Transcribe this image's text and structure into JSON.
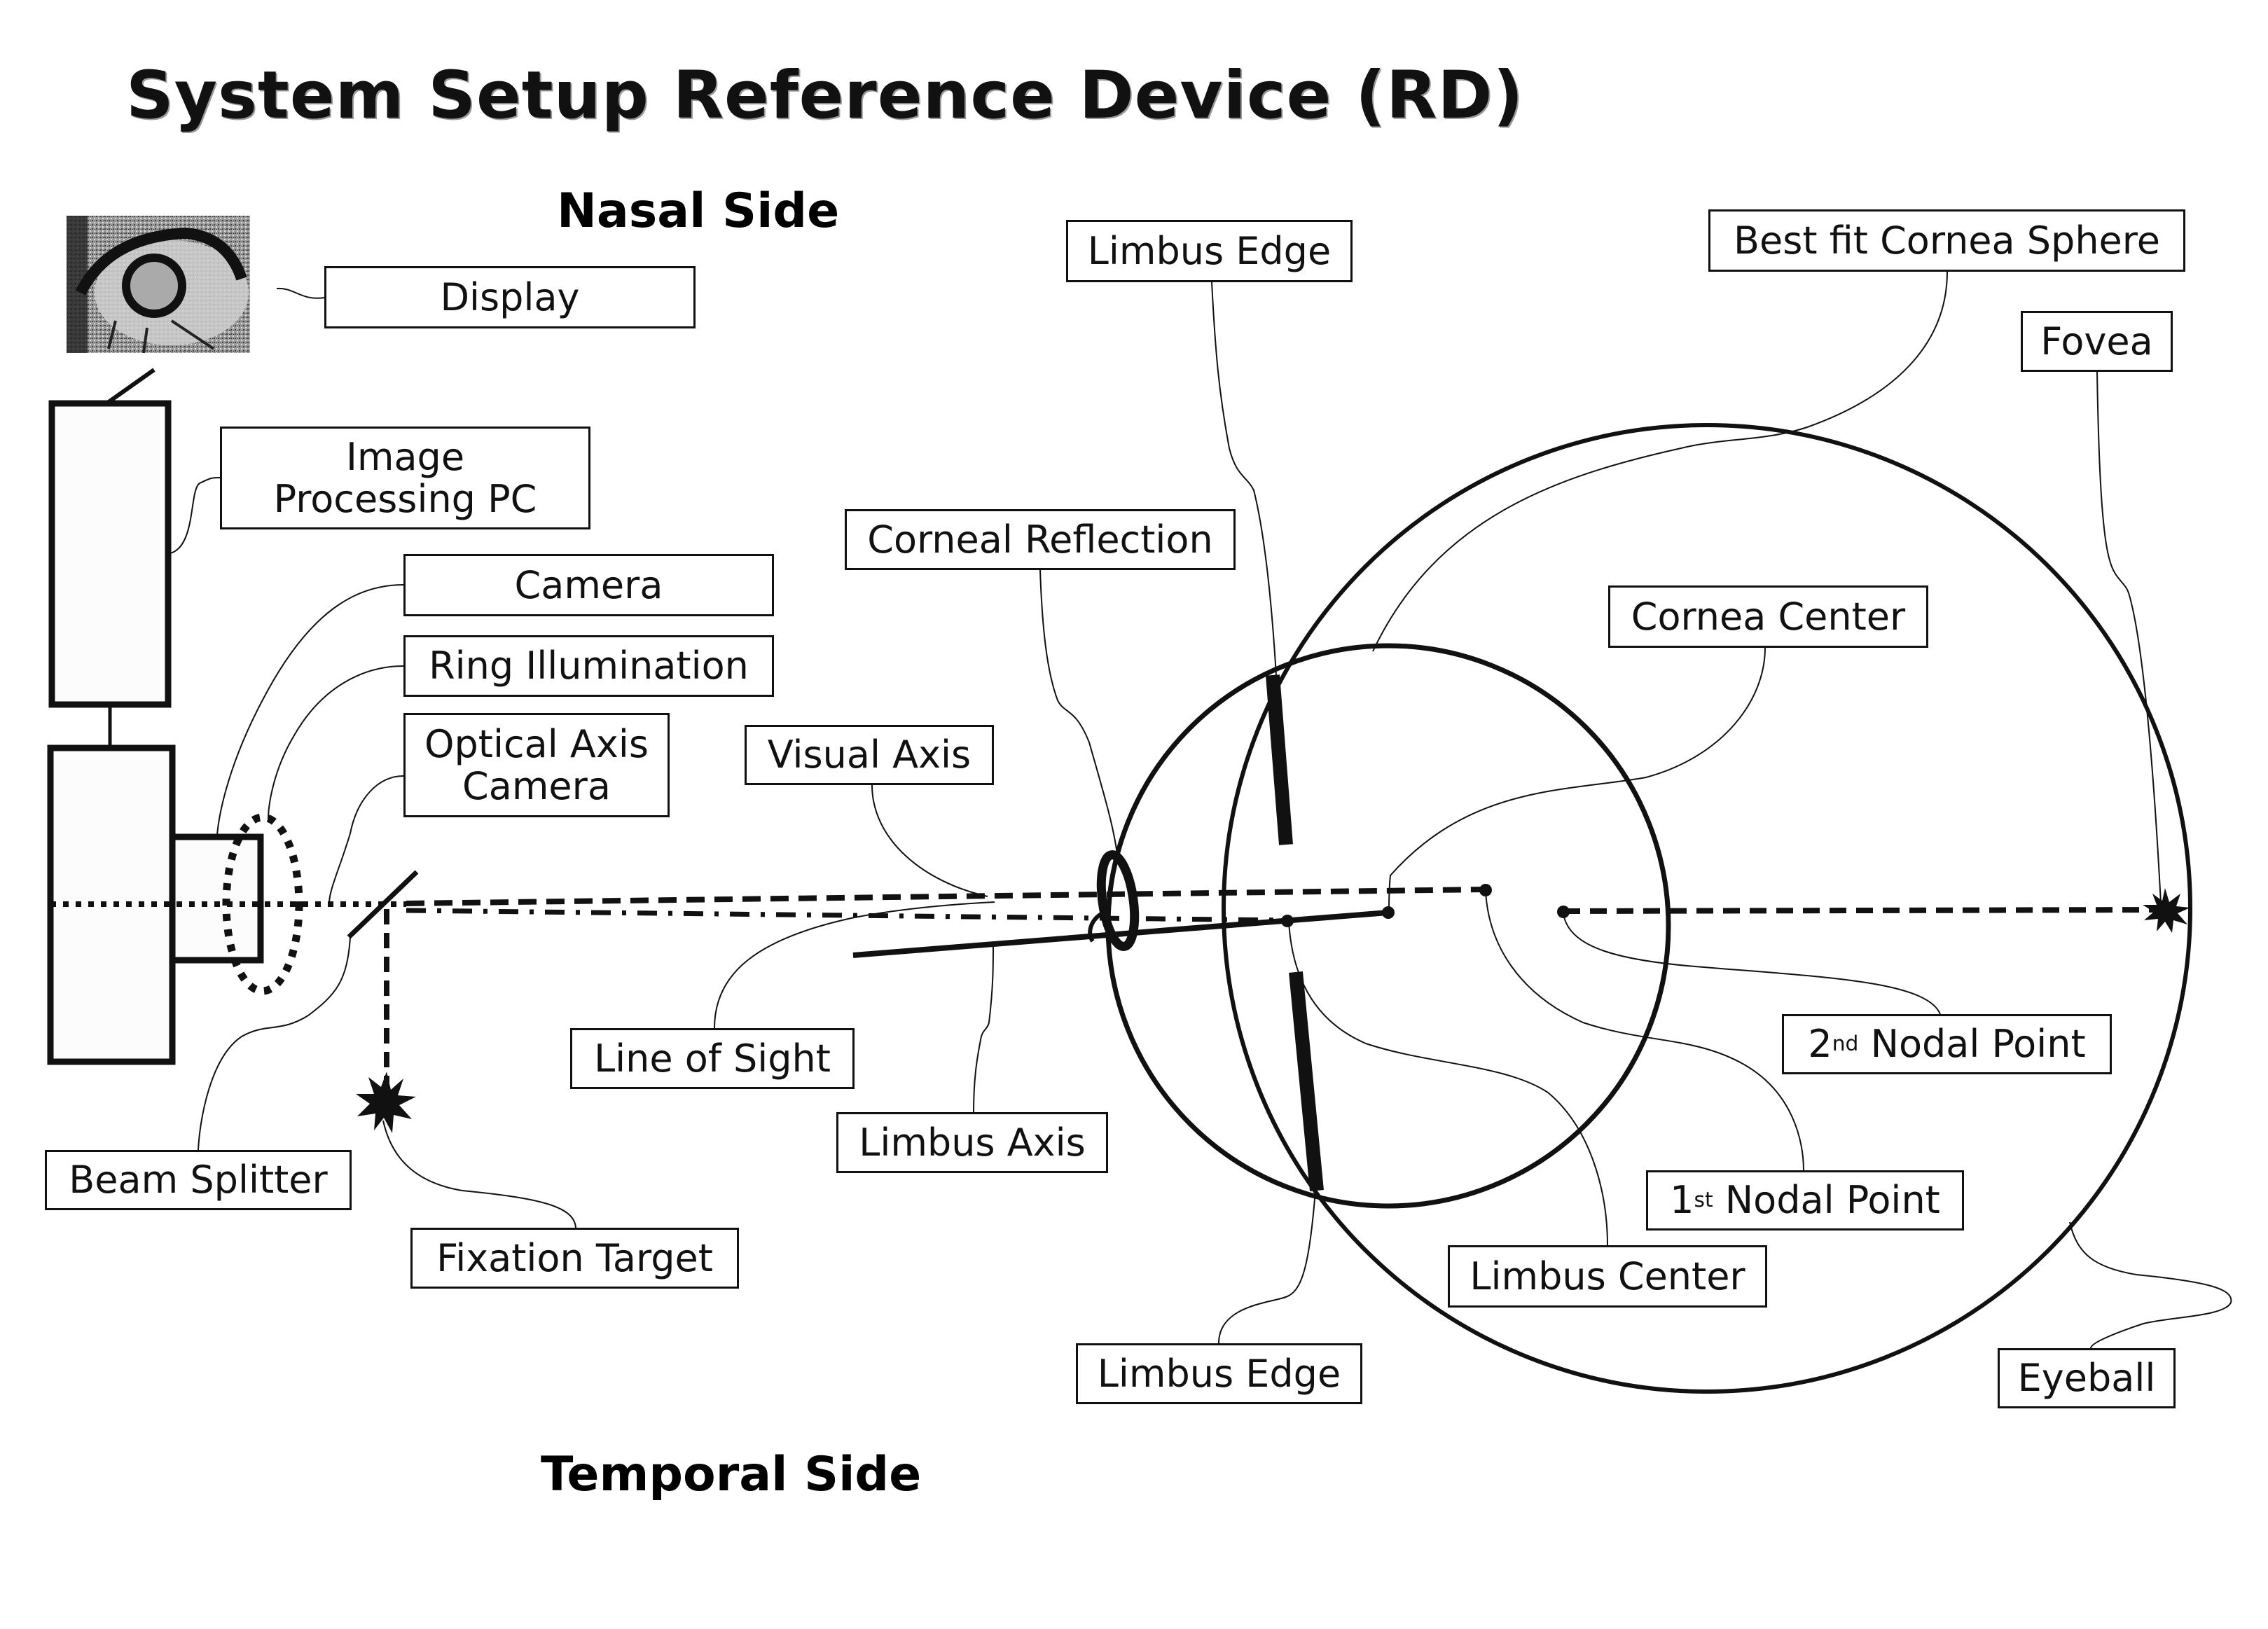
{
  "title": "System Setup Reference Device (RD)",
  "orientation": {
    "top": "Nasal Side",
    "bottom": "Temporal Side"
  },
  "labels": {
    "display": "Display",
    "image_processing_pc_line1": "Image",
    "image_processing_pc_line2": "Processing PC",
    "camera": "Camera",
    "ring_illumination": "Ring Illumination",
    "optical_axis_camera_line1": "Optical Axis",
    "optical_axis_camera_line2": "Camera",
    "beam_splitter": "Beam Splitter",
    "fixation_target": "Fixation Target",
    "line_of_sight": "Line of Sight",
    "limbus_axis": "Limbus Axis",
    "visual_axis": "Visual Axis",
    "corneal_reflection": "Corneal Reflection",
    "limbus_edge_top": "Limbus Edge",
    "best_fit_cornea_sphere": "Best fit Cornea Sphere",
    "fovea": "Fovea",
    "cornea_center": "Cornea Center",
    "second_nodal_point": {
      "num": "2",
      "sup": "nd",
      "text": " Nodal Point"
    },
    "first_nodal_point": {
      "num": "1",
      "sup": "st",
      "text": " Nodal Point"
    },
    "limbus_center": "Limbus Center",
    "limbus_edge_bottom": "Limbus Edge",
    "eyeball": "Eyeball"
  },
  "icons": {
    "display_thumbnail": "eye-photo-icon",
    "fixation_target": "starburst-icon",
    "fovea_marker": "starburst-icon"
  },
  "colors": {
    "ink": "#111111",
    "background": "#ffffff"
  }
}
